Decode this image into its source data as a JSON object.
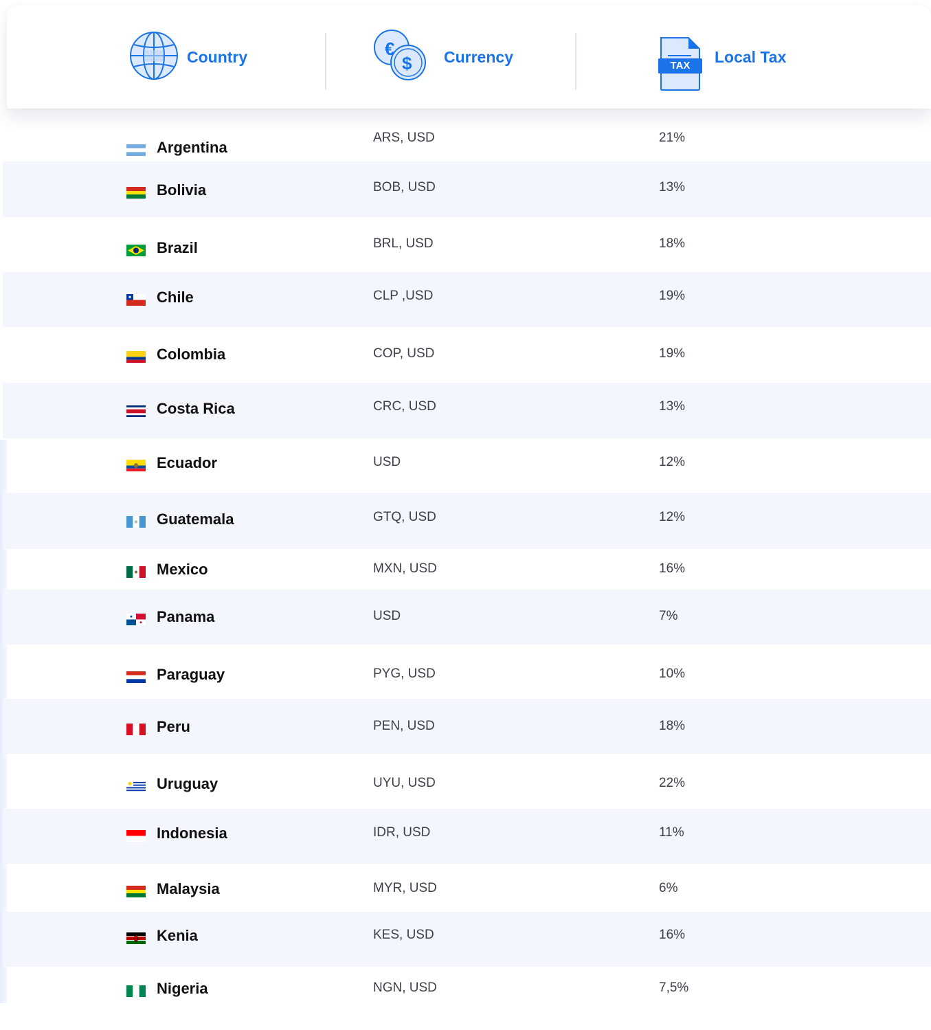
{
  "header": {
    "columns": [
      {
        "label": "Country",
        "icon": "globe-icon"
      },
      {
        "label": "Currency",
        "icon": "coins-icon"
      },
      {
        "label": "Local Tax",
        "icon": "tax-document-icon",
        "badge": "TAX"
      }
    ]
  },
  "colors": {
    "accent": "#1a73e8",
    "row_alt": "#f3f7fd",
    "icon_fill": "#dce8fb"
  },
  "rows": [
    {
      "country": "Argentina",
      "currency": "ARS, USD",
      "tax": "21%",
      "flag": "argentina-flag"
    },
    {
      "country": "Bolivia",
      "currency": "BOB, USD",
      "tax": "13%",
      "flag": "bolivia-flag"
    },
    {
      "country": "Brazil",
      "currency": "BRL, USD",
      "tax": "18%",
      "flag": "brazil-flag"
    },
    {
      "country": "Chile",
      "currency": "CLP ,USD",
      "tax": "19%",
      "flag": "chile-flag"
    },
    {
      "country": "Colombia",
      "currency": "COP, USD",
      "tax": "19%",
      "flag": "colombia-flag"
    },
    {
      "country": "Costa Rica",
      "currency": "CRC, USD",
      "tax": "13%",
      "flag": "costa-rica-flag"
    },
    {
      "country": "Ecuador",
      "currency": "USD",
      "tax": "12%",
      "flag": "ecuador-flag"
    },
    {
      "country": "Guatemala",
      "currency": "GTQ, USD",
      "tax": "12%",
      "flag": "guatemala-flag"
    },
    {
      "country": "Mexico",
      "currency": "MXN, USD",
      "tax": "16%",
      "flag": "mexico-flag"
    },
    {
      "country": "Panama",
      "currency": "USD",
      "tax": "7%",
      "flag": "panama-flag"
    },
    {
      "country": "Paraguay",
      "currency": "PYG, USD",
      "tax": "10%",
      "flag": "paraguay-flag"
    },
    {
      "country": "Peru",
      "currency": "PEN, USD",
      "tax": "18%",
      "flag": "peru-flag"
    },
    {
      "country": "Uruguay",
      "currency": "UYU, USD",
      "tax": "22%",
      "flag": "uruguay-flag"
    },
    {
      "country": "Indonesia",
      "currency": "IDR, USD",
      "tax": "11%",
      "flag": "indonesia-flag"
    },
    {
      "country": "Malaysia",
      "currency": "MYR, USD",
      "tax": "6%",
      "flag": "malaysia-flag"
    },
    {
      "country": "Kenia",
      "currency": "KES, USD",
      "tax": "16%",
      "flag": "kenya-flag"
    },
    {
      "country": "Nigeria",
      "currency": "NGN, USD",
      "tax": "7,5%",
      "flag": "nigeria-flag"
    }
  ]
}
